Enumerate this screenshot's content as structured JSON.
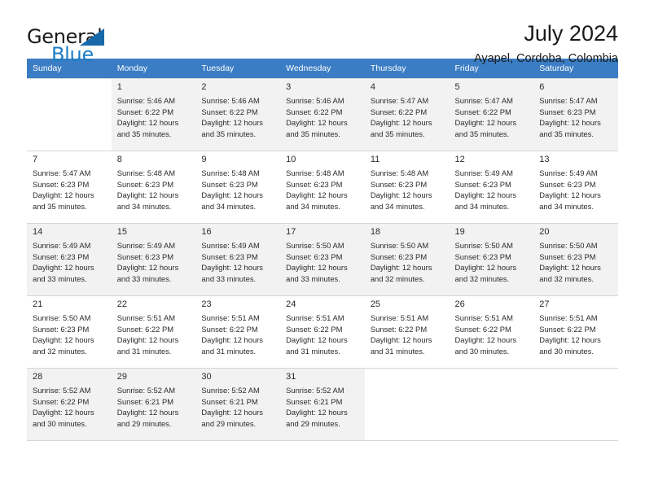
{
  "brand": {
    "name_part1": "General",
    "name_part2": "Blue",
    "logo_icon": "triangle-logo-icon",
    "accent_color": "#1d7cc4"
  },
  "header": {
    "title": "July 2024",
    "subtitle": "Ayapel, Cordoba, Colombia"
  },
  "calendar": {
    "header_bg": "#3b7dc4",
    "weekday_headers": [
      "Sunday",
      "Monday",
      "Tuesday",
      "Wednesday",
      "Thursday",
      "Friday",
      "Saturday"
    ],
    "weeks": [
      [
        {
          "day": "",
          "sunrise": "",
          "sunset": "",
          "daylight_line1": "",
          "daylight_line2": "",
          "empty": true
        },
        {
          "day": "1",
          "sunrise": "Sunrise: 5:46 AM",
          "sunset": "Sunset: 6:22 PM",
          "daylight_line1": "Daylight: 12 hours",
          "daylight_line2": "and 35 minutes."
        },
        {
          "day": "2",
          "sunrise": "Sunrise: 5:46 AM",
          "sunset": "Sunset: 6:22 PM",
          "daylight_line1": "Daylight: 12 hours",
          "daylight_line2": "and 35 minutes."
        },
        {
          "day": "3",
          "sunrise": "Sunrise: 5:46 AM",
          "sunset": "Sunset: 6:22 PM",
          "daylight_line1": "Daylight: 12 hours",
          "daylight_line2": "and 35 minutes."
        },
        {
          "day": "4",
          "sunrise": "Sunrise: 5:47 AM",
          "sunset": "Sunset: 6:22 PM",
          "daylight_line1": "Daylight: 12 hours",
          "daylight_line2": "and 35 minutes."
        },
        {
          "day": "5",
          "sunrise": "Sunrise: 5:47 AM",
          "sunset": "Sunset: 6:22 PM",
          "daylight_line1": "Daylight: 12 hours",
          "daylight_line2": "and 35 minutes."
        },
        {
          "day": "6",
          "sunrise": "Sunrise: 5:47 AM",
          "sunset": "Sunset: 6:23 PM",
          "daylight_line1": "Daylight: 12 hours",
          "daylight_line2": "and 35 minutes."
        }
      ],
      [
        {
          "day": "7",
          "sunrise": "Sunrise: 5:47 AM",
          "sunset": "Sunset: 6:23 PM",
          "daylight_line1": "Daylight: 12 hours",
          "daylight_line2": "and 35 minutes."
        },
        {
          "day": "8",
          "sunrise": "Sunrise: 5:48 AM",
          "sunset": "Sunset: 6:23 PM",
          "daylight_line1": "Daylight: 12 hours",
          "daylight_line2": "and 34 minutes."
        },
        {
          "day": "9",
          "sunrise": "Sunrise: 5:48 AM",
          "sunset": "Sunset: 6:23 PM",
          "daylight_line1": "Daylight: 12 hours",
          "daylight_line2": "and 34 minutes."
        },
        {
          "day": "10",
          "sunrise": "Sunrise: 5:48 AM",
          "sunset": "Sunset: 6:23 PM",
          "daylight_line1": "Daylight: 12 hours",
          "daylight_line2": "and 34 minutes."
        },
        {
          "day": "11",
          "sunrise": "Sunrise: 5:48 AM",
          "sunset": "Sunset: 6:23 PM",
          "daylight_line1": "Daylight: 12 hours",
          "daylight_line2": "and 34 minutes."
        },
        {
          "day": "12",
          "sunrise": "Sunrise: 5:49 AM",
          "sunset": "Sunset: 6:23 PM",
          "daylight_line1": "Daylight: 12 hours",
          "daylight_line2": "and 34 minutes."
        },
        {
          "day": "13",
          "sunrise": "Sunrise: 5:49 AM",
          "sunset": "Sunset: 6:23 PM",
          "daylight_line1": "Daylight: 12 hours",
          "daylight_line2": "and 34 minutes."
        }
      ],
      [
        {
          "day": "14",
          "sunrise": "Sunrise: 5:49 AM",
          "sunset": "Sunset: 6:23 PM",
          "daylight_line1": "Daylight: 12 hours",
          "daylight_line2": "and 33 minutes."
        },
        {
          "day": "15",
          "sunrise": "Sunrise: 5:49 AM",
          "sunset": "Sunset: 6:23 PM",
          "daylight_line1": "Daylight: 12 hours",
          "daylight_line2": "and 33 minutes."
        },
        {
          "day": "16",
          "sunrise": "Sunrise: 5:49 AM",
          "sunset": "Sunset: 6:23 PM",
          "daylight_line1": "Daylight: 12 hours",
          "daylight_line2": "and 33 minutes."
        },
        {
          "day": "17",
          "sunrise": "Sunrise: 5:50 AM",
          "sunset": "Sunset: 6:23 PM",
          "daylight_line1": "Daylight: 12 hours",
          "daylight_line2": "and 33 minutes."
        },
        {
          "day": "18",
          "sunrise": "Sunrise: 5:50 AM",
          "sunset": "Sunset: 6:23 PM",
          "daylight_line1": "Daylight: 12 hours",
          "daylight_line2": "and 32 minutes."
        },
        {
          "day": "19",
          "sunrise": "Sunrise: 5:50 AM",
          "sunset": "Sunset: 6:23 PM",
          "daylight_line1": "Daylight: 12 hours",
          "daylight_line2": "and 32 minutes."
        },
        {
          "day": "20",
          "sunrise": "Sunrise: 5:50 AM",
          "sunset": "Sunset: 6:23 PM",
          "daylight_line1": "Daylight: 12 hours",
          "daylight_line2": "and 32 minutes."
        }
      ],
      [
        {
          "day": "21",
          "sunrise": "Sunrise: 5:50 AM",
          "sunset": "Sunset: 6:23 PM",
          "daylight_line1": "Daylight: 12 hours",
          "daylight_line2": "and 32 minutes."
        },
        {
          "day": "22",
          "sunrise": "Sunrise: 5:51 AM",
          "sunset": "Sunset: 6:22 PM",
          "daylight_line1": "Daylight: 12 hours",
          "daylight_line2": "and 31 minutes."
        },
        {
          "day": "23",
          "sunrise": "Sunrise: 5:51 AM",
          "sunset": "Sunset: 6:22 PM",
          "daylight_line1": "Daylight: 12 hours",
          "daylight_line2": "and 31 minutes."
        },
        {
          "day": "24",
          "sunrise": "Sunrise: 5:51 AM",
          "sunset": "Sunset: 6:22 PM",
          "daylight_line1": "Daylight: 12 hours",
          "daylight_line2": "and 31 minutes."
        },
        {
          "day": "25",
          "sunrise": "Sunrise: 5:51 AM",
          "sunset": "Sunset: 6:22 PM",
          "daylight_line1": "Daylight: 12 hours",
          "daylight_line2": "and 31 minutes."
        },
        {
          "day": "26",
          "sunrise": "Sunrise: 5:51 AM",
          "sunset": "Sunset: 6:22 PM",
          "daylight_line1": "Daylight: 12 hours",
          "daylight_line2": "and 30 minutes."
        },
        {
          "day": "27",
          "sunrise": "Sunrise: 5:51 AM",
          "sunset": "Sunset: 6:22 PM",
          "daylight_line1": "Daylight: 12 hours",
          "daylight_line2": "and 30 minutes."
        }
      ],
      [
        {
          "day": "28",
          "sunrise": "Sunrise: 5:52 AM",
          "sunset": "Sunset: 6:22 PM",
          "daylight_line1": "Daylight: 12 hours",
          "daylight_line2": "and 30 minutes."
        },
        {
          "day": "29",
          "sunrise": "Sunrise: 5:52 AM",
          "sunset": "Sunset: 6:21 PM",
          "daylight_line1": "Daylight: 12 hours",
          "daylight_line2": "and 29 minutes."
        },
        {
          "day": "30",
          "sunrise": "Sunrise: 5:52 AM",
          "sunset": "Sunset: 6:21 PM",
          "daylight_line1": "Daylight: 12 hours",
          "daylight_line2": "and 29 minutes."
        },
        {
          "day": "31",
          "sunrise": "Sunrise: 5:52 AM",
          "sunset": "Sunset: 6:21 PM",
          "daylight_line1": "Daylight: 12 hours",
          "daylight_line2": "and 29 minutes."
        },
        {
          "day": "",
          "sunrise": "",
          "sunset": "",
          "daylight_line1": "",
          "daylight_line2": "",
          "empty": true
        },
        {
          "day": "",
          "sunrise": "",
          "sunset": "",
          "daylight_line1": "",
          "daylight_line2": "",
          "empty": true
        },
        {
          "day": "",
          "sunrise": "",
          "sunset": "",
          "daylight_line1": "",
          "daylight_line2": "",
          "empty": true
        }
      ]
    ]
  }
}
